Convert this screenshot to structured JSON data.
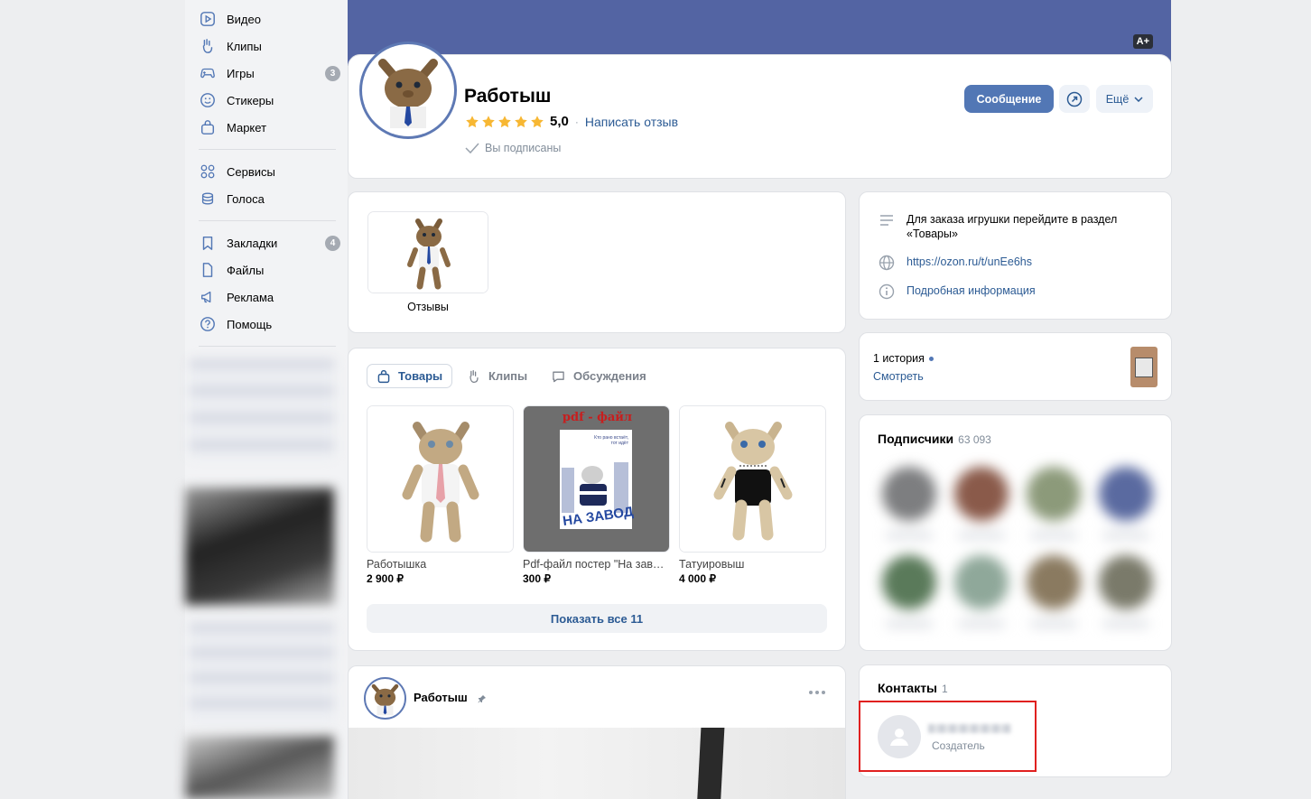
{
  "nav": {
    "items": [
      {
        "label": "Видео",
        "icon": "video-icon"
      },
      {
        "label": "Клипы",
        "icon": "clips-icon"
      },
      {
        "label": "Игры",
        "icon": "games-icon",
        "badge": "3"
      },
      {
        "label": "Стикеры",
        "icon": "stickers-icon"
      },
      {
        "label": "Маркет",
        "icon": "market-icon"
      },
      {
        "label": "Сервисы",
        "icon": "services-icon"
      },
      {
        "label": "Голоса",
        "icon": "votes-icon"
      },
      {
        "label": "Закладки",
        "icon": "bookmark-icon",
        "badge": "4"
      },
      {
        "label": "Файлы",
        "icon": "files-icon"
      },
      {
        "label": "Реклама",
        "icon": "ads-icon"
      },
      {
        "label": "Помощь",
        "icon": "help-icon"
      }
    ]
  },
  "header": {
    "font_size_badge": "A+",
    "title": "Работыш",
    "rating": "5,0",
    "stars": 5,
    "review_link": "Написать отзыв",
    "subscribed": "Вы подписаны",
    "message_button": "Сообщение",
    "more_button": "Ещё"
  },
  "reviews_card": {
    "label": "Отзывы"
  },
  "tabs": [
    {
      "label": "Товары",
      "icon": "bag-icon"
    },
    {
      "label": "Клипы",
      "icon": "clips-icon"
    },
    {
      "label": "Обсуждения",
      "icon": "chat-icon"
    }
  ],
  "products": [
    {
      "title": "Работышка",
      "price": "2 900 ₽"
    },
    {
      "title": "Pdf-файл постер \"На завод\"",
      "price": "300 ₽",
      "poster_top": "pdf - файл",
      "poster_note": "Кто рано встаёт, тот идёт",
      "poster_bottom": "НА ЗАВОД"
    },
    {
      "title": "Татуировыш",
      "price": "4 000 ₽"
    }
  ],
  "show_all_button": "Показать все 11",
  "post": {
    "author": "Работыш"
  },
  "info": {
    "description": "Для заказа игрушки перейдите в раздел «Товары»",
    "link": "https://ozon.ru/t/unEe6hs",
    "more_info": "Подробная информация"
  },
  "stories": {
    "count_label": "1 история",
    "watch": "Смотреть"
  },
  "subscribers": {
    "title": "Подписчики",
    "count": "63 093"
  },
  "contacts": {
    "title": "Контакты",
    "count": "1",
    "role": "Создатель"
  },
  "colors": {
    "cover": "#5364a3",
    "accent": "#5277b5",
    "link": "#2c5b94",
    "star": "#f7b733",
    "highlight_box": "#e0201f"
  }
}
